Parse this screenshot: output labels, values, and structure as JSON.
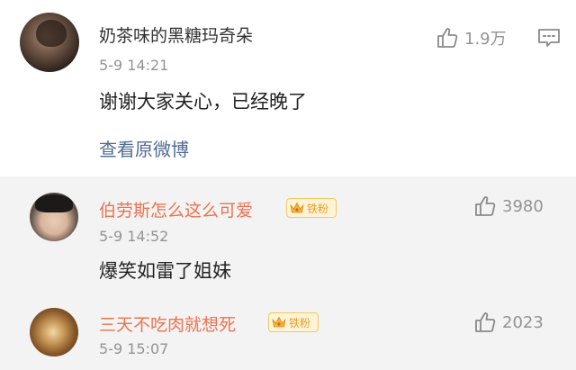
{
  "main_comment": {
    "username": "奶茶味的黑糖玛奇朵",
    "timestamp": "5-9 14:21",
    "text": "谢谢大家关心，已经晚了",
    "like_count": "1.9万",
    "view_original_label": "查看原微博"
  },
  "replies": [
    {
      "username": "伯劳斯怎么这么可爱",
      "badge": "铁粉",
      "timestamp": "5-9 14:52",
      "text": "爆笑如雷了姐妹",
      "like_count": "3980"
    },
    {
      "username": "三天不吃肉就想死",
      "badge": "铁粉",
      "timestamp": "5-9 15:07",
      "text": "",
      "like_count": "2023"
    }
  ],
  "icons": {
    "like": "thumbs-up-icon",
    "comment": "comment-bubble-icon",
    "badge": "crown-icon"
  },
  "colors": {
    "reply_username": "#eb7350",
    "link": "#506b93",
    "meta": "#939393",
    "badge_text": "#e0a12a"
  }
}
